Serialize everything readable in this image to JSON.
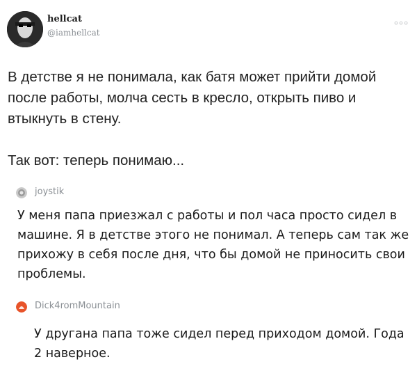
{
  "tweet": {
    "display_name": "hellcat",
    "handle": "@iamhellcat",
    "more_icon": "more-dots-icon",
    "text_p1": "В детстве я не понимала, как батя может прийти домой после работы, молча сесть в кресло, открыть пиво и втыкнуть в стену.",
    "text_p2": "Так вот: теперь понимаю..."
  },
  "comments": [
    {
      "username": "joystik",
      "avatar_icon": "grey-avatar-icon",
      "text": "У меня папа приезжал с работы и пол часа просто сидел в машине. Я в детстве этого не понимал. А теперь сам так же прихожу в себя после дня, что бы домой не приносить свои проблемы."
    },
    {
      "username": "Dick4romMountain",
      "avatar_icon": "orange-avatar-icon",
      "text": "У другана папа тоже сидел перед приходом домой. Года 2 наверное."
    }
  ],
  "colors": {
    "avatar_orange": "#e8542a",
    "muted_text": "#8a8f94"
  }
}
